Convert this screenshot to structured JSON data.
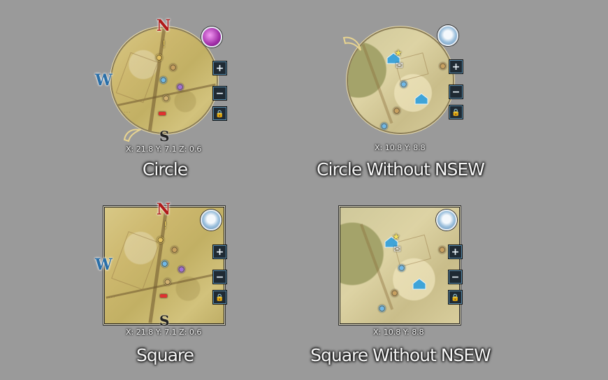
{
  "variants": [
    {
      "id": "circle",
      "label": "Circle",
      "coords": "X: 21.8 Y: 7.1 Z: 0.6",
      "compass": {
        "n": "N",
        "w": "W",
        "s": "S"
      },
      "weather": "purple-orb-icon"
    },
    {
      "id": "circle-no-nsew",
      "label": "Circle Without NSEW",
      "coords": "X: 10.8 Y: 8.8",
      "weather": "cloud-orb-icon"
    },
    {
      "id": "square",
      "label": "Square",
      "coords": "X: 21.8 Y: 7.1 Z: 0.6",
      "compass": {
        "n": "N",
        "w": "W",
        "s": "S"
      },
      "weather": "cloud-orb-icon"
    },
    {
      "id": "square-no-nsew",
      "label": "Square Without NSEW",
      "coords": "X: 10.8 Y: 8.8",
      "weather": "cloud-orb-icon"
    }
  ],
  "controls": {
    "zoom_in": "+",
    "zoom_out": "−",
    "lock": "🔒"
  },
  "colors": {
    "background": "#9a9a9a",
    "north": "#b01a1a",
    "west": "#2a6fa8",
    "control_bg": "#1f2a33"
  }
}
